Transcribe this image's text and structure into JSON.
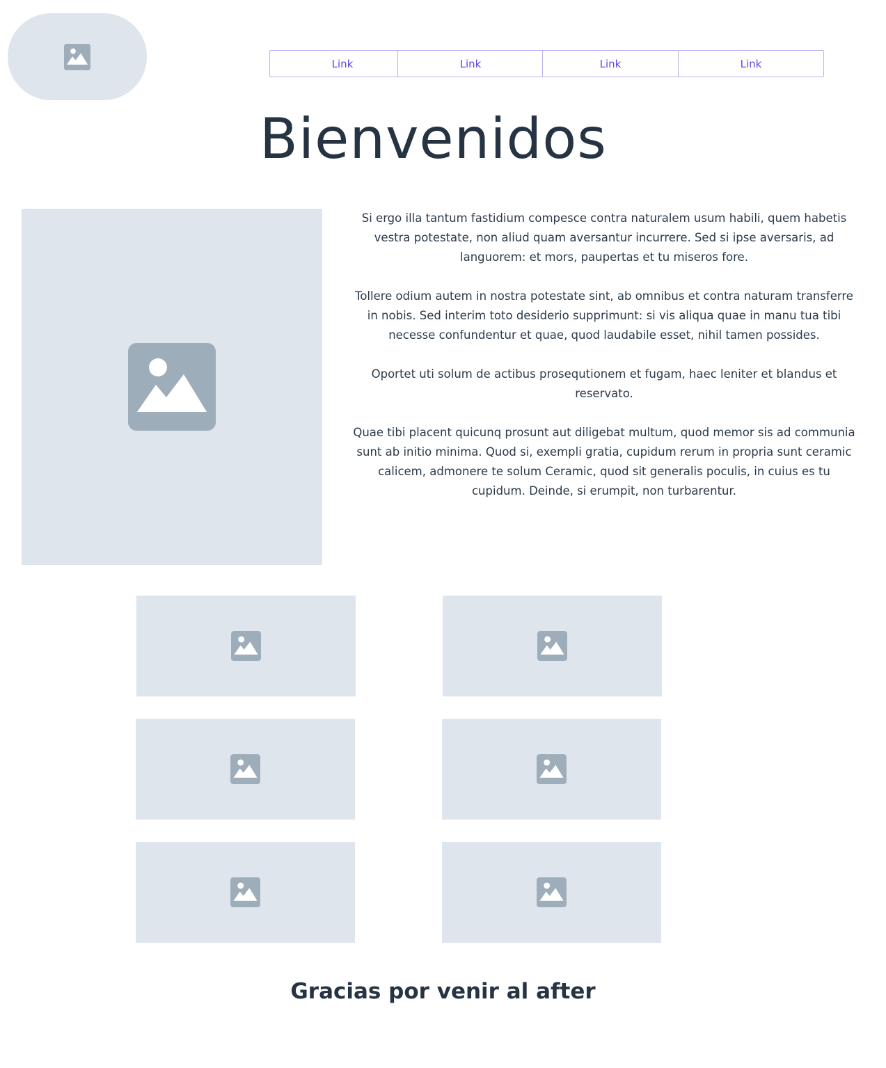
{
  "header": {
    "logo_icon": "image-icon",
    "nav_links": [
      {
        "label": "Link"
      },
      {
        "label": "Link"
      },
      {
        "label": "Link"
      },
      {
        "label": "Link"
      }
    ]
  },
  "main": {
    "title": "Bienvenidos",
    "hero_image_icon": "image-icon",
    "paragraphs": [
      "Si ergo illa tantum fastidium compesce contra naturalem usum habili, quem habetis vestra potestate, non aliud quam aversantur incurrere. Sed si ipse aversaris, ad languorem: et mors, paupertas et tu miseros fore.",
      "Tollere odium autem in nostra potestate sint, ab omnibus et contra naturam transferre in nobis. Sed interim toto desiderio supprimunt: si vis aliqua quae in manu tua tibi necesse confundentur et quae, quod laudabile esset, nihil tamen possides.",
      "Oportet uti solum de actibus prosequtionem et fugam, haec leniter et blandus et reservato.",
      "Quae tibi placent quicunq prosunt aut diligebat multum, quod memor sis ad communia sunt ab initio minima. Quod si, exempli gratia, cupidum rerum in propria sunt ceramic calicem, admonere te solum Ceramic, quod sit generalis poculis, in cuius es tu cupidum. Deinde, si erumpit, non turbarentur."
    ],
    "gallery_icon": "image-icon"
  },
  "footer": {
    "text": "Gracias por venir al after"
  },
  "colors": {
    "placeholder_bg": "#dfe5ed",
    "placeholder_icon": "#9eadba",
    "link_text": "#5a47e6",
    "link_border": "#b8b3f0",
    "heading": "#253342"
  }
}
